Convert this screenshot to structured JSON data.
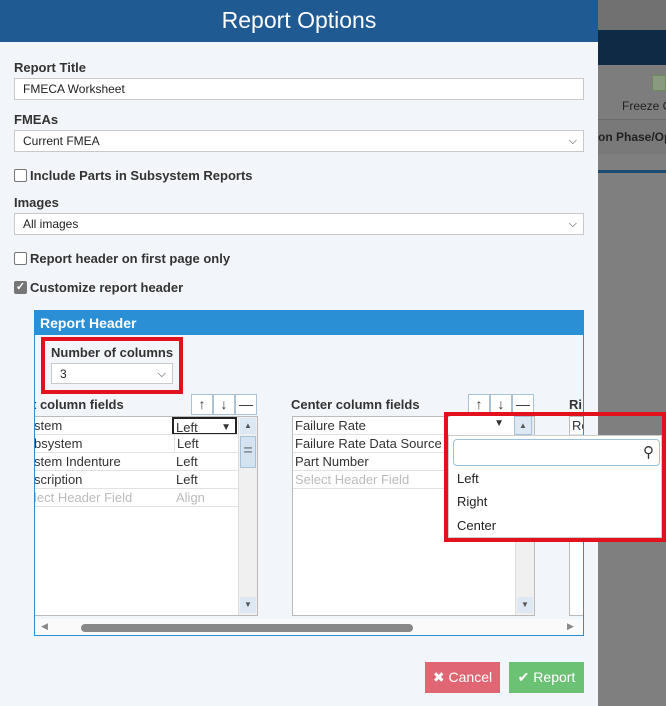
{
  "background": {
    "toolbar_label": "Freeze C",
    "column_label": "on Phase/Op"
  },
  "dialog": {
    "title": "Report Options",
    "report_title": {
      "label": "Report Title",
      "value": "FMECA Worksheet"
    },
    "fmeas": {
      "label": "FMEAs",
      "value": "Current FMEA"
    },
    "include_parts": {
      "label": "Include Parts in Subsystem Reports",
      "checked": false
    },
    "images": {
      "label": "Images",
      "value": "All images"
    },
    "header_first_page": {
      "label": "Report header on first page only",
      "checked": false
    },
    "customize_header": {
      "label": "Customize report header",
      "checked": true
    },
    "report_header": {
      "title": "Report Header",
      "num_columns": {
        "label": "Number of columns",
        "value": "3"
      },
      "left": {
        "label": "t column fields",
        "rows": [
          {
            "field": "stem",
            "align": "Left"
          },
          {
            "field": "bsystem",
            "align": "Left"
          },
          {
            "field": "stem Indenture",
            "align": "Left"
          },
          {
            "field": "scription",
            "align": "Left"
          }
        ],
        "placeholder_field": "lect Header Field",
        "placeholder_align": "Align"
      },
      "center": {
        "label": "Center column fields",
        "rows": [
          {
            "field": "Failure Rate"
          },
          {
            "field": "Failure Rate Data Source"
          },
          {
            "field": "Part Number"
          }
        ],
        "placeholder_field": "Select Header Field"
      },
      "right": {
        "label": "Ri",
        "first": "Re"
      },
      "align_dropdown": {
        "search_placeholder": "",
        "options": [
          "Left",
          "Right",
          "Center"
        ]
      }
    },
    "buttons": {
      "cancel": "Cancel",
      "report": "Report"
    },
    "colors": {
      "title_bar": "#1f5a93",
      "panel": "#2a8fd4",
      "cancel": "#e06673",
      "report": "#6cc274",
      "highlight": "#e3101e"
    }
  }
}
